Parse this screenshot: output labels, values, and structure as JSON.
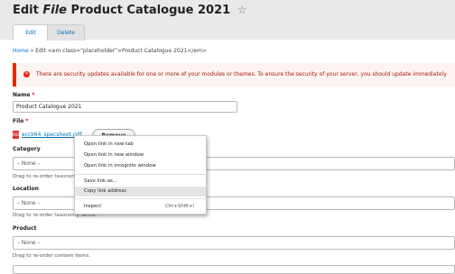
{
  "page": {
    "title_prefix": "Edit",
    "title_em": "File",
    "title_rest": "Product Catalogue 2021",
    "star": "☆"
  },
  "tabs": [
    {
      "label": "Edit"
    },
    {
      "label": "Delete"
    }
  ],
  "breadcrumb": {
    "home": "Home",
    "separator": "»",
    "current": "Edit <em class=\"placeholder\">Product Catalogue 2021</em>"
  },
  "message": {
    "icon": "error-icon",
    "text": "There are security updates available for one or more of your modules or themes. To ensure the security of your server, you should update immediately"
  },
  "form": {
    "name": {
      "label": "Name",
      "value": "Product Catalogue 2021"
    },
    "file": {
      "label": "File",
      "filename": "ecck64_specsheet.pdf",
      "remove_label": "Remove"
    },
    "category": {
      "label": "Category",
      "value": "– None –",
      "help": "Drag to re-order taxonomy terms."
    },
    "location": {
      "label": "Location",
      "value": "– None –",
      "help": "Drag to re-order taxonomy terms."
    },
    "product": {
      "label": "Product",
      "value": "– None –",
      "help": "Drag to re-order content items."
    },
    "required_marker": "*"
  },
  "context_menu": {
    "items": [
      {
        "label": "Open link in new tab"
      },
      {
        "label": "Open link in new window"
      },
      {
        "label": "Open link in incognito window"
      },
      {
        "label": "Save link as..."
      },
      {
        "label": "Copy link address"
      },
      {
        "label": "Inspect",
        "shortcut": "Ctrl+Shift+I"
      }
    ]
  },
  "colors": {
    "link": "#0074bd",
    "error": "#e62600",
    "header_bg": "#e9e9e9"
  }
}
